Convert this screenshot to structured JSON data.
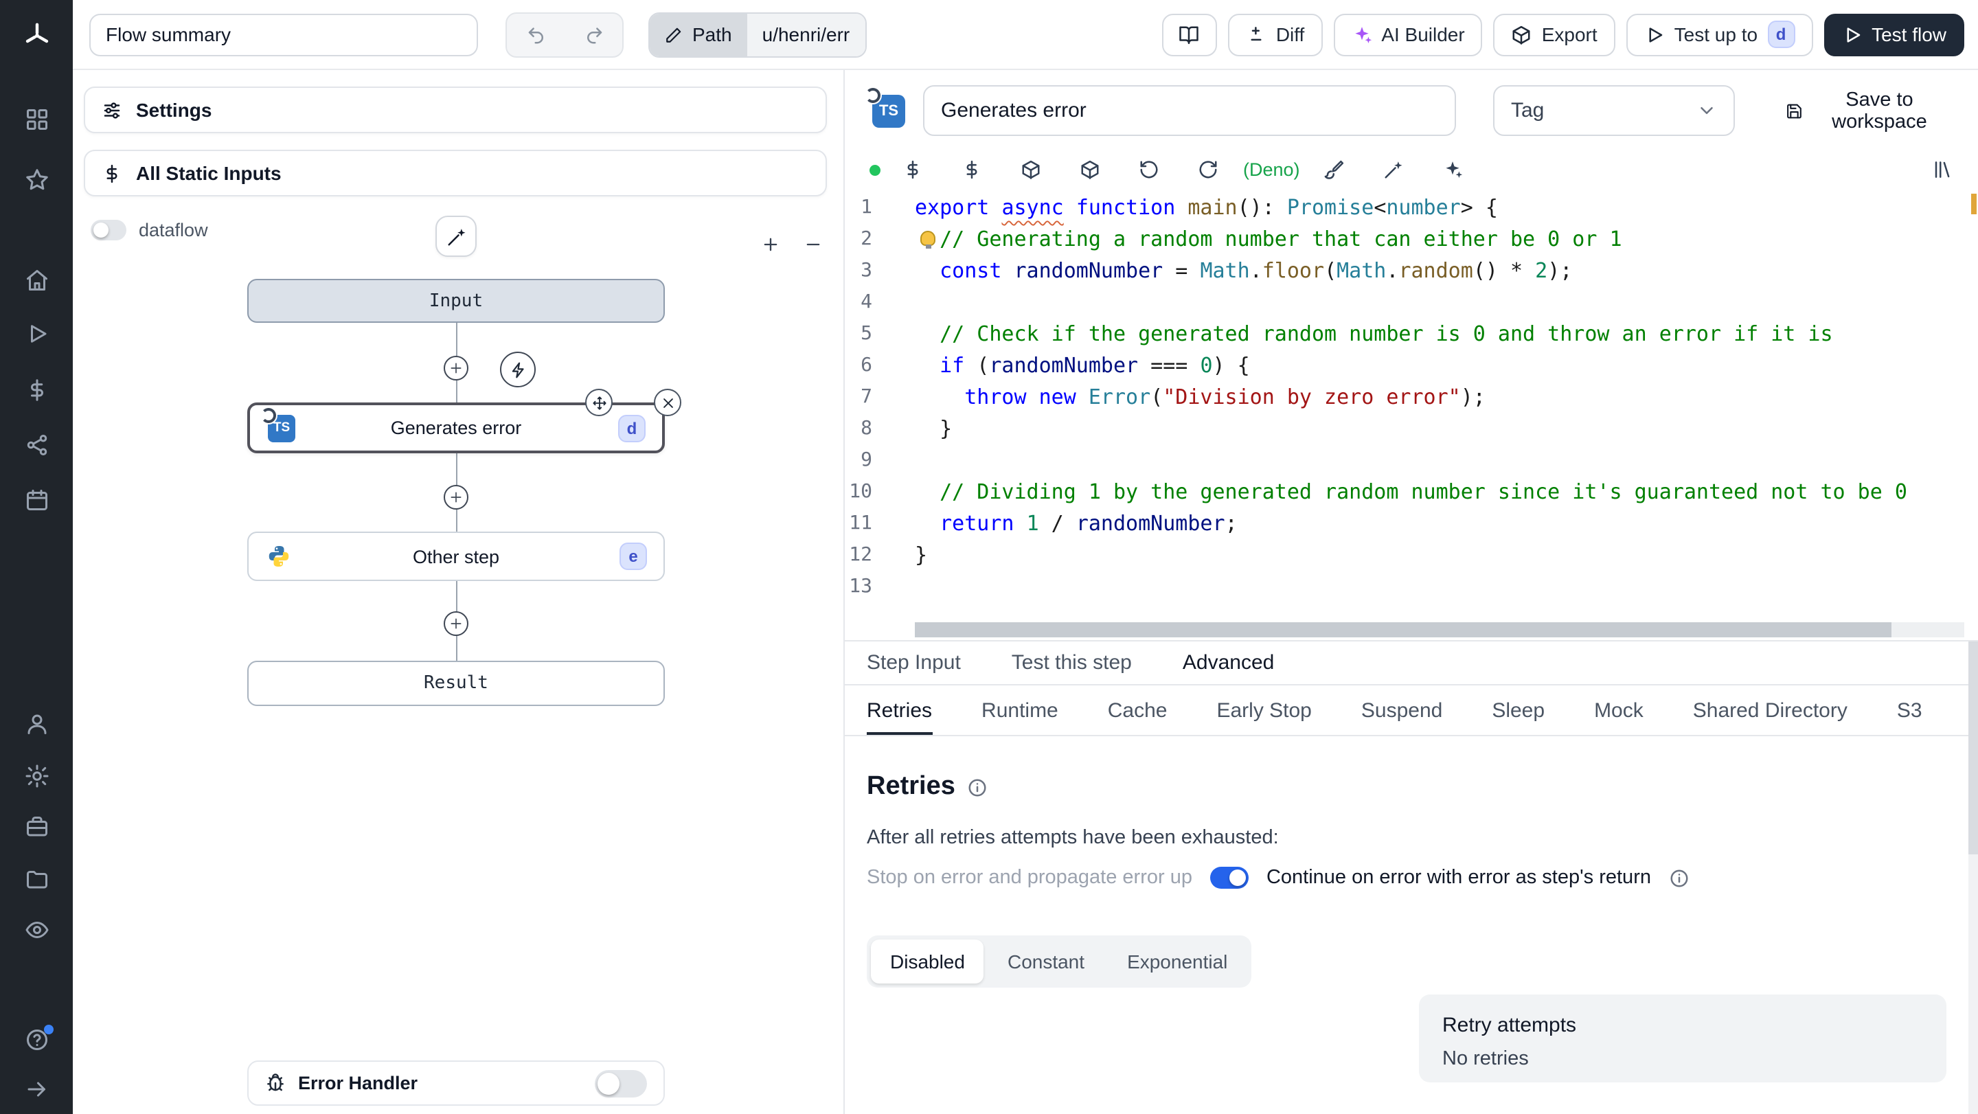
{
  "colors": {
    "sidebar_bg": "#20252b",
    "accent_blue": "#2563eb",
    "badge_bg": "#dbe3fd",
    "badge_text": "#3f51c9",
    "deno_green": "#16a34a",
    "ts_blue": "#3178c6",
    "dark_button": "#1f2937",
    "modified_marker": "#e0a63a",
    "status_dot": "#22c55e"
  },
  "icons": [
    "windmill-logo",
    "grid-icon",
    "star-icon",
    "home-icon",
    "play-icon",
    "dollar-icon",
    "share-icon",
    "calendar-icon",
    "user-icon",
    "gear-icon",
    "briefcase-icon",
    "folder-icon",
    "eye-icon",
    "help-icon",
    "arrow-right-icon",
    "undo-icon",
    "redo-icon",
    "pencil-icon",
    "book-open-icon",
    "diff-icon",
    "sparkles-icon",
    "package-icon",
    "sliders-icon",
    "magic-wand-icon",
    "plus-circle-icon",
    "bolt-icon",
    "move-icon",
    "close-icon",
    "python-icon",
    "bug-icon",
    "save-icon",
    "chevron-down-icon",
    "refresh-icon",
    "brush-icon",
    "library-icon",
    "info-icon",
    "lightbulb-icon"
  ],
  "topbar": {
    "flow_summary": "Flow summary",
    "path_label": "Path",
    "path_value": "u/henri/err",
    "diff": "Diff",
    "ai_builder": "AI Builder",
    "export": "Export",
    "test_up_to": "Test up to",
    "test_up_to_badge": "d",
    "test_flow": "Test flow"
  },
  "flow_panel": {
    "settings": "Settings",
    "all_static_inputs": "All Static Inputs",
    "dataflow": "dataflow",
    "input_node": "Input",
    "step_node": {
      "label": "Generates error",
      "badge": "d"
    },
    "other_node": {
      "label": "Other step",
      "badge": "e"
    },
    "result_node": "Result",
    "error_handler": "Error Handler"
  },
  "step_editor": {
    "name": "Generates error",
    "tag": "Tag",
    "save": "Save to workspace",
    "runtime": "(Deno)",
    "ts_label": "TS",
    "bulb_line": 2,
    "code": [
      [
        [
          "kw",
          "export"
        ],
        [
          "pl",
          " "
        ],
        [
          "kwsq",
          "async"
        ],
        [
          "pl",
          " "
        ],
        [
          "kw",
          "function"
        ],
        [
          "pl",
          " "
        ],
        [
          "fn",
          "main"
        ],
        [
          "pl",
          "(): "
        ],
        [
          "type",
          "Promise"
        ],
        [
          "pl",
          "<"
        ],
        [
          "type",
          "number"
        ],
        [
          "pl",
          "> {"
        ]
      ],
      [
        [
          "pl",
          "  "
        ],
        [
          "com",
          "// Generating a random number that can either be 0 or 1"
        ]
      ],
      [
        [
          "pl",
          "  "
        ],
        [
          "kw",
          "const"
        ],
        [
          "pl",
          " "
        ],
        [
          "var",
          "randomNumber"
        ],
        [
          "pl",
          " = "
        ],
        [
          "type",
          "Math"
        ],
        [
          "pl",
          "."
        ],
        [
          "fn",
          "floor"
        ],
        [
          "pl",
          "("
        ],
        [
          "type",
          "Math"
        ],
        [
          "pl",
          "."
        ],
        [
          "fn",
          "random"
        ],
        [
          "pl",
          "() * "
        ],
        [
          "num",
          "2"
        ],
        [
          "pl",
          ");"
        ]
      ],
      [],
      [
        [
          "pl",
          "  "
        ],
        [
          "com",
          "// Check if the generated random number is 0 and throw an error if it is"
        ]
      ],
      [
        [
          "pl",
          "  "
        ],
        [
          "kw",
          "if"
        ],
        [
          "pl",
          " ("
        ],
        [
          "var",
          "randomNumber"
        ],
        [
          "pl",
          " === "
        ],
        [
          "num",
          "0"
        ],
        [
          "pl",
          ") {"
        ]
      ],
      [
        [
          "pl",
          "    "
        ],
        [
          "kw",
          "throw"
        ],
        [
          "pl",
          " "
        ],
        [
          "kw",
          "new"
        ],
        [
          "pl",
          " "
        ],
        [
          "type",
          "Error"
        ],
        [
          "pl",
          "("
        ],
        [
          "str",
          "\"Division by zero error\""
        ],
        [
          "pl",
          ");"
        ]
      ],
      [
        [
          "pl",
          "  }"
        ]
      ],
      [],
      [
        [
          "pl",
          "  "
        ],
        [
          "com",
          "// Dividing 1 by the generated random number since it's guaranteed not to be 0"
        ]
      ],
      [
        [
          "pl",
          "  "
        ],
        [
          "kw",
          "return"
        ],
        [
          "pl",
          " "
        ],
        [
          "num",
          "1"
        ],
        [
          "pl",
          " / "
        ],
        [
          "var",
          "randomNumber"
        ],
        [
          "pl",
          ";"
        ]
      ],
      [
        [
          "pl",
          "}"
        ]
      ],
      []
    ]
  },
  "tabs": {
    "items": [
      "Step Input",
      "Test this step",
      "Advanced"
    ],
    "active": "Advanced",
    "subitems": [
      "Retries",
      "Runtime",
      "Cache",
      "Early Stop",
      "Suspend",
      "Sleep",
      "Mock",
      "Shared Directory",
      "S3"
    ],
    "active_sub": "Retries"
  },
  "retries": {
    "title": "Retries",
    "exhausted_text": "After all retries attempts have been exhausted:",
    "stop_option": "Stop on error and propagate error up",
    "continue_option": "Continue on error with error as step's return",
    "modes": [
      "Disabled",
      "Constant",
      "Exponential"
    ],
    "active_mode": "Disabled",
    "card": {
      "title": "Retry attempts",
      "value": "No retries"
    }
  }
}
